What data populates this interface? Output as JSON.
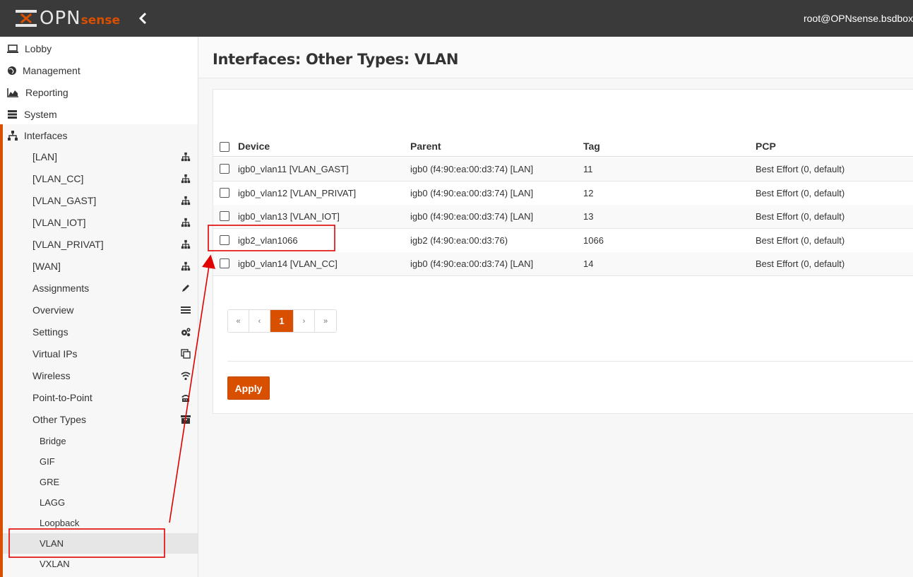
{
  "header": {
    "logo_text_main": "OPN",
    "logo_text_accent": "sense",
    "user": "root@OPNsense.bsdbox.lc"
  },
  "sidebar": {
    "items": [
      {
        "label": "Lobby",
        "icon": "laptop-icon"
      },
      {
        "label": "Management",
        "icon": "globe-icon"
      },
      {
        "label": "Reporting",
        "icon": "area-chart-icon"
      },
      {
        "label": "System",
        "icon": "server-icon"
      },
      {
        "label": "Interfaces",
        "icon": "sitemap-icon"
      }
    ],
    "interfaces_sub": [
      {
        "label": "[LAN]",
        "icon": "sitemap-icon"
      },
      {
        "label": "[VLAN_CC]",
        "icon": "sitemap-icon"
      },
      {
        "label": "[VLAN_GAST]",
        "icon": "sitemap-icon"
      },
      {
        "label": "[VLAN_IOT]",
        "icon": "sitemap-icon"
      },
      {
        "label": "[VLAN_PRIVAT]",
        "icon": "sitemap-icon"
      },
      {
        "label": "[WAN]",
        "icon": "sitemap-icon"
      },
      {
        "label": "Assignments",
        "icon": "pencil-icon"
      },
      {
        "label": "Overview",
        "icon": "list-icon"
      },
      {
        "label": "Settings",
        "icon": "cogs-icon"
      },
      {
        "label": "Virtual IPs",
        "icon": "clone-icon"
      },
      {
        "label": "Wireless",
        "icon": "wifi-icon"
      },
      {
        "label": "Point-to-Point",
        "icon": "fax-icon"
      },
      {
        "label": "Other Types",
        "icon": "archive-icon"
      }
    ],
    "other_types_sub": [
      {
        "label": "Bridge"
      },
      {
        "label": "GIF"
      },
      {
        "label": "GRE"
      },
      {
        "label": "LAGG"
      },
      {
        "label": "Loopback"
      },
      {
        "label": "VLAN",
        "active": true
      },
      {
        "label": "VXLAN"
      }
    ]
  },
  "main": {
    "title": "Interfaces: Other Types: VLAN",
    "table": {
      "columns": [
        "Device",
        "Parent",
        "Tag",
        "PCP"
      ],
      "rows": [
        {
          "device": "igb0_vlan11 [VLAN_GAST]",
          "parent": "igb0 (f4:90:ea:00:d3:74) [LAN]",
          "tag": "11",
          "pcp": "Best Effort (0, default)"
        },
        {
          "device": "igb0_vlan12 [VLAN_PRIVAT]",
          "parent": "igb0 (f4:90:ea:00:d3:74) [LAN]",
          "tag": "12",
          "pcp": "Best Effort (0, default)"
        },
        {
          "device": "igb0_vlan13 [VLAN_IOT]",
          "parent": "igb0 (f4:90:ea:00:d3:74) [LAN]",
          "tag": "13",
          "pcp": "Best Effort (0, default)"
        },
        {
          "device": "igb2_vlan1066",
          "parent": "igb2 (f4:90:ea:00:d3:76)",
          "tag": "1066",
          "pcp": "Best Effort (0, default)"
        },
        {
          "device": "igb0_vlan14 [VLAN_CC]",
          "parent": "igb0 (f4:90:ea:00:d3:74) [LAN]",
          "tag": "14",
          "pcp": "Best Effort (0, default)"
        }
      ]
    },
    "pagination": {
      "first": "«",
      "prev": "‹",
      "current": "1",
      "next": "›",
      "last": "»"
    },
    "apply_label": "Apply"
  },
  "colors": {
    "brand": "#d94f00",
    "topbar": "#3a3a3a",
    "annotation": "#e00000"
  }
}
